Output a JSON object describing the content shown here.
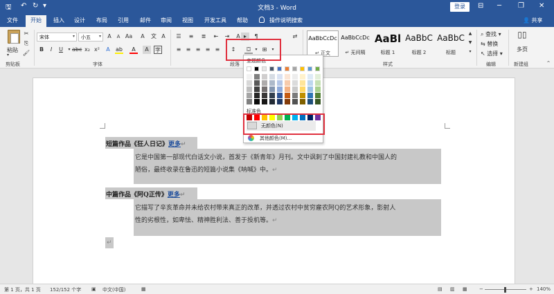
{
  "titlebar": {
    "doc_title": "文档3 - Word",
    "login": "登录",
    "minimize": "─",
    "restore": "❐",
    "close": "✕",
    "ribbon_toggle": "⊟"
  },
  "quick_access": {
    "save": "🖫",
    "undo": "↶",
    "redo": "↻",
    "more": "▾"
  },
  "tabs": [
    {
      "label": "文件"
    },
    {
      "label": "开始"
    },
    {
      "label": "插入"
    },
    {
      "label": "设计"
    },
    {
      "label": "布局"
    },
    {
      "label": "引用"
    },
    {
      "label": "邮件"
    },
    {
      "label": "审阅"
    },
    {
      "label": "视图"
    },
    {
      "label": "开发工具"
    },
    {
      "label": "帮助"
    }
  ],
  "tell_me": "操作说明搜索",
  "share": "共享",
  "ribbon": {
    "clipboard": {
      "paste": "粘贴",
      "label": "剪贴板"
    },
    "font": {
      "font_name": "宋体",
      "font_size": "小五",
      "bold": "B",
      "italic": "I",
      "underline": "U",
      "label": "字体"
    },
    "paragraph": {
      "label": "段落"
    },
    "styles": {
      "label": "样式",
      "items": [
        {
          "sample": "AaBbCcDc",
          "name": "↵ 正文"
        },
        {
          "sample": "AaBbCcDc",
          "name": "↵ 无间隔"
        },
        {
          "sample": "AaBl",
          "name": "标题 1"
        },
        {
          "sample": "AaBbC",
          "name": "标题 2"
        },
        {
          "sample": "AaBbC",
          "name": "标题"
        }
      ]
    },
    "editing": {
      "find": "查找",
      "replace": "替换",
      "select": "选择",
      "label": "编辑"
    },
    "new_group": {
      "button": "多页",
      "label": "新建组"
    }
  },
  "color_popup": {
    "theme_title": "主题颜色",
    "standard_title": "标准色",
    "no_color": "无颜色(N)",
    "more_colors": "其他颜色(M)...",
    "theme_top": [
      "#ffffff",
      "#000000",
      "#e7e6e6",
      "#44546a",
      "#4472c4",
      "#ed7d31",
      "#a5a5a5",
      "#ffc000",
      "#5b9bd5",
      "#70ad47"
    ],
    "theme_shades": [
      [
        "#f2f2f2",
        "#7f7f7f",
        "#d0cece",
        "#d6dce4",
        "#d9e2f3",
        "#fbe5d5",
        "#ededed",
        "#fff2cc",
        "#deebf6",
        "#e2efd9"
      ],
      [
        "#d8d8d8",
        "#595959",
        "#aeabab",
        "#adb9ca",
        "#b4c6e7",
        "#f7cbac",
        "#dbdbdb",
        "#fee599",
        "#bdd7ee",
        "#c5e0b3"
      ],
      [
        "#bfbfbf",
        "#3f3f3f",
        "#757070",
        "#8496b0",
        "#8eaadb",
        "#f4b183",
        "#c9c9c9",
        "#ffd965",
        "#9cc3e5",
        "#a8d08d"
      ],
      [
        "#a5a5a5",
        "#262626",
        "#3a3838",
        "#323f4f",
        "#2f5496",
        "#c55a11",
        "#7b7b7b",
        "#bf9000",
        "#2e75b5",
        "#538135"
      ],
      [
        "#7f7f7f",
        "#0c0c0c",
        "#171616",
        "#222a35",
        "#1f3864",
        "#833c0b",
        "#525252",
        "#7f6000",
        "#1e4e79",
        "#375623"
      ]
    ],
    "standard": [
      "#c00000",
      "#ff0000",
      "#ffc000",
      "#ffff00",
      "#92d050",
      "#00b050",
      "#00b0f0",
      "#0070c0",
      "#002060",
      "#7030a0"
    ]
  },
  "document": {
    "heading1": "短篇作品《狂人日记》",
    "heading1_link": "更多",
    "para1_line1": "它是中国第一部现代白话文小说，首发于《新青年》月刊。文中讽刺了中国封建礼教和中国人的",
    "para1_line2": "陋俗，最终收录在鲁迅的短篇小说集《呐喊》中。",
    "heading2": "中篇作品《阿Q正传》",
    "heading2_link": "更多",
    "para2_line1": "它描写了辛亥革命并未给农村带来真正的改革，并透过农村中贫穷雇农阿Q的艺术形象，影射人",
    "para2_line2": "性的劣根性，如卑怯、精神胜利法、善于投机等。",
    "pmark": "↵"
  },
  "statusbar": {
    "page": "第 1 页，共 1 页",
    "words": "152/152 个字",
    "language": "中文(中国)",
    "zoom_minus": "−",
    "zoom_plus": "+",
    "zoom": "140%"
  }
}
